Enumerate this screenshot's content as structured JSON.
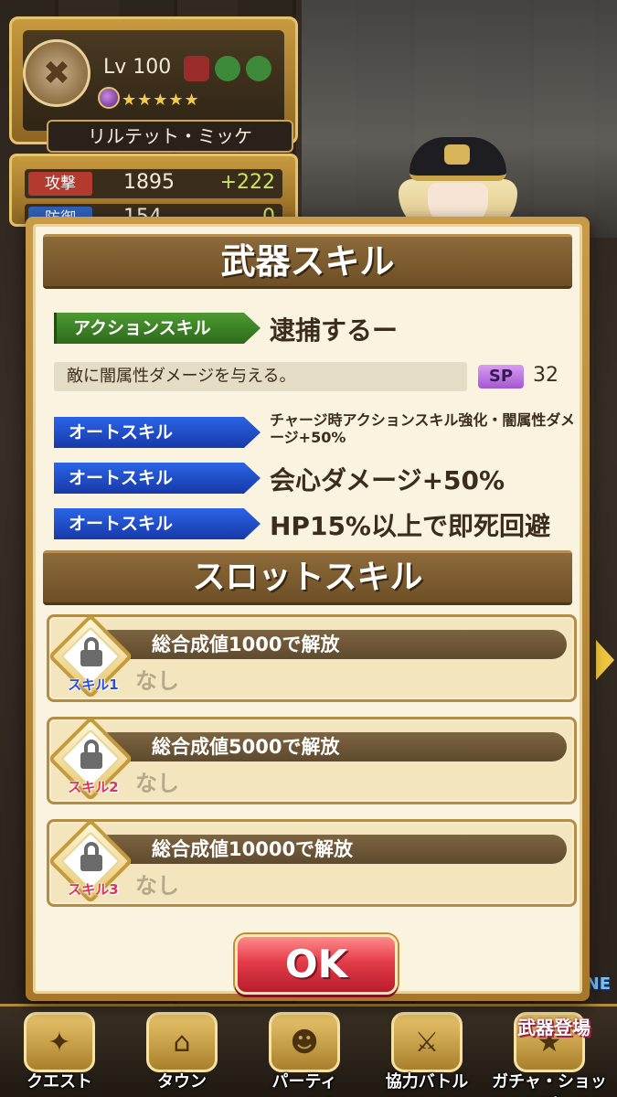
{
  "header": {
    "level": "Lv 100",
    "stars": "★★★★★",
    "character_name": "リルテット・ミッケ"
  },
  "stats": {
    "attack_label": "攻撃",
    "attack_value": "1895",
    "attack_bonus": "+222",
    "defense_label": "防御",
    "defense_value": "154",
    "defense_bonus": "0"
  },
  "dialog": {
    "title": "武器スキル",
    "action_skill": {
      "tag": "アクションスキル",
      "name": "逮捕するー",
      "description": "敵に闇属性ダメージを与える。",
      "sp_label": "SP",
      "sp_value": "32"
    },
    "auto_skills": [
      {
        "tag": "オートスキル",
        "name": "チャージ時アクションスキル強化・闇属性ダメージ+50%"
      },
      {
        "tag": "オートスキル",
        "name": "会心ダメージ+50%"
      },
      {
        "tag": "オートスキル",
        "name": "HP15%以上で即死回避"
      }
    ],
    "slot_title": "スロットスキル",
    "slots": [
      {
        "label": "スキル1",
        "unlock": "総合成値1000で解放",
        "value": "なし"
      },
      {
        "label": "スキル2",
        "unlock": "総合成値5000で解放",
        "value": "なし"
      },
      {
        "label": "スキル3",
        "unlock": "総合成値10000で解放",
        "value": "なし"
      }
    ],
    "ok_label": "OK"
  },
  "bottom_nav": [
    {
      "label": "クエスト",
      "icon": "quest-icon"
    },
    {
      "label": "タウン",
      "icon": "town-icon"
    },
    {
      "label": "パーティ",
      "icon": "party-icon"
    },
    {
      "label": "協力バトル",
      "icon": "coop-battle-icon"
    },
    {
      "label": "ガチャ・ショップ",
      "icon": "gacha-shop-icon"
    }
  ],
  "promo": {
    "tag": "NE",
    "text": "武器登場"
  },
  "colors": {
    "action_tag": "#2c6a1a",
    "auto_tag": "#1739a8",
    "ok_button": "#e43c4b",
    "header_bar": "#6e4f26"
  }
}
